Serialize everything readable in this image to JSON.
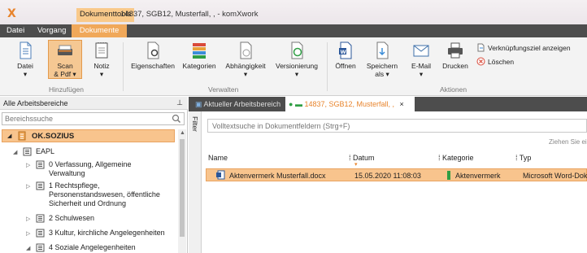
{
  "titlebar": {
    "context_tab": "Dokumenttools",
    "window_title": "14837, SGB12, Musterfall, ,  - komXwork"
  },
  "menu": {
    "tabs": [
      "Datei",
      "Vorgang",
      "Dokumente"
    ],
    "active": "Dokumente"
  },
  "ribbon": {
    "groups": {
      "hinzufuegen": "Hinzufügen",
      "verwalten": "Verwalten",
      "aktionen": "Aktionen"
    },
    "buttons": {
      "datei": "Datei",
      "scan_line1": "Scan",
      "scan_line2": "& Pdf ▾",
      "notiz": "Notiz",
      "eigenschaften": "Eigenschaften",
      "kategorien": "Kategorien",
      "abhaengigkeit": "Abhängigkeit",
      "versionierung": "Versionierung",
      "oeffnen": "Öffnen",
      "speichern_line1": "Speichern",
      "speichern_line2": "als ▾",
      "email_line1": "E-Mail",
      "email_line2": "▾",
      "drucken": "Drucken",
      "verknuepfungsziel": "Verknüpfungsziel anzeigen",
      "loeschen": "Löschen"
    }
  },
  "leftpane": {
    "header": "Alle Arbeitsbereiche",
    "pin": "ᵽ",
    "search_placeholder": "Bereichssuche",
    "root": "OK.SOZIUS",
    "nodes": [
      {
        "label": "EAPL"
      },
      {
        "line1": "0  Verfassung, Allgemeine",
        "line2": "Verwaltung"
      },
      {
        "line1": "1  Rechtspflege,",
        "line2": "Personenstandswesen, öffentliche",
        "line3": "Sicherheit und Ordnung"
      },
      {
        "label": "2  Schulwesen"
      },
      {
        "label": "3  Kultur, kirchliche Angelegenheiten"
      },
      {
        "label": "4  Soziale Angelegenheiten"
      }
    ]
  },
  "doctabs": {
    "workspace": "Aktueller Arbeitsbereich",
    "case": "14837, SGB12, Musterfall, ,",
    "close": "×"
  },
  "content": {
    "filter": "Filter",
    "fulltext_placeholder": "Volltextsuche in Dokumentfeldern (Strg+F)",
    "hint": "Ziehen Sie eine S",
    "columns": {
      "name": "Name",
      "datum": "Datum",
      "kategorie": "Kategorie",
      "typ": "Typ"
    },
    "rows": [
      {
        "name": "Aktenvermerk Musterfall.docx",
        "datum": "15.05.2020 11:08:03",
        "kategorie": "Aktenvermerk",
        "typ": "Microsoft Word-Dok"
      }
    ]
  },
  "colors": {
    "accent": "#f0a85a",
    "selection": "#f8c48d",
    "dark_bar": "#4d4d4d",
    "category_green": "#2f9e44"
  }
}
